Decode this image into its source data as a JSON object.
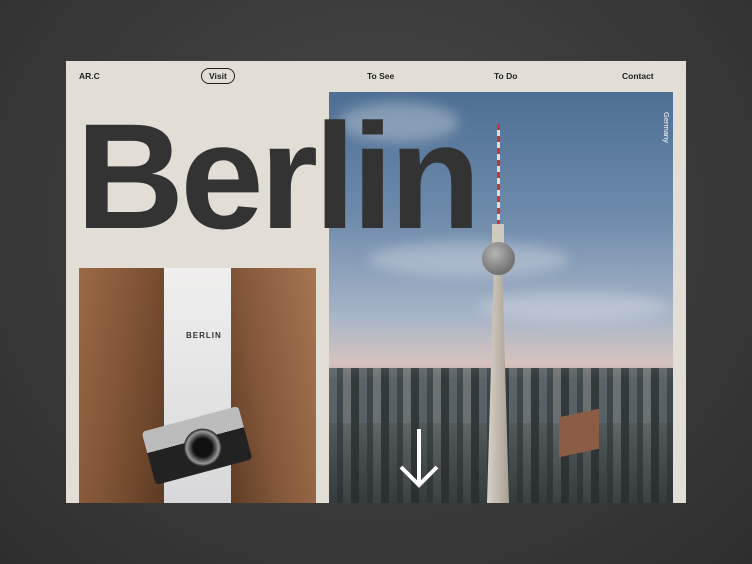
{
  "nav": {
    "brand": "AR.C",
    "items": [
      {
        "label": "Visit",
        "active": true
      },
      {
        "label": "To See"
      },
      {
        "label": "To Do"
      },
      {
        "label": "Contact"
      }
    ]
  },
  "hero": {
    "title": "Berlin",
    "side_label": "Germany",
    "shirt_text": "BERLIN"
  },
  "colors": {
    "background": "#e2ded6",
    "text": "#333333"
  }
}
